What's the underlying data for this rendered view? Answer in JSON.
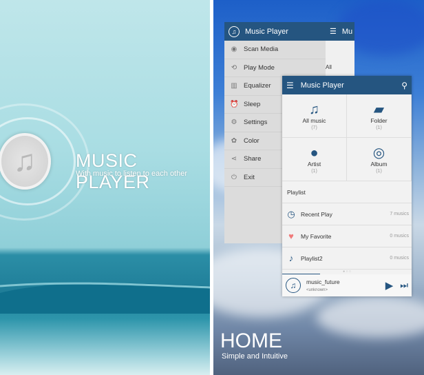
{
  "splash": {
    "title": "MUSIC PLAYER",
    "subtitle": "With music to listen to each other",
    "logo_icon": "music-note-icon"
  },
  "home": {
    "title": "HOME",
    "subtitle": "Simple and Intuitive"
  },
  "drawer": {
    "title": "Music Player",
    "items": [
      {
        "label": "Scan Media",
        "icon": "disc-icon"
      },
      {
        "label": "Play Mode",
        "icon": "repeat-icon"
      },
      {
        "label": "Equalizer",
        "icon": "equalizer-icon"
      },
      {
        "label": "Sleep",
        "icon": "alarm-icon"
      },
      {
        "label": "Settings",
        "icon": "gear-icon"
      },
      {
        "label": "Color",
        "icon": "palette-icon"
      },
      {
        "label": "Share",
        "icon": "share-icon"
      },
      {
        "label": "Exit",
        "icon": "power-icon"
      }
    ]
  },
  "back_screen": {
    "title": "Mu",
    "label": "All"
  },
  "main": {
    "title": "Music Player",
    "categories": [
      {
        "label": "All music",
        "count": "(7)"
      },
      {
        "label": "Folder",
        "count": "(1)"
      },
      {
        "label": "Artist",
        "count": "(1)"
      },
      {
        "label": "Album",
        "count": "(1)"
      }
    ],
    "playlist_header": "Playlist",
    "playlists": [
      {
        "label": "Recent Play",
        "count": "7 musics"
      },
      {
        "label": "My Favorite",
        "count": "0 musics"
      },
      {
        "label": "Playlist2",
        "count": "0 musics"
      }
    ],
    "now_playing": {
      "title": "music_future",
      "artist": "<unknown>",
      "progress": 0.29
    },
    "colors": {
      "header": "#255580",
      "favorite": "#f07a7a"
    }
  }
}
